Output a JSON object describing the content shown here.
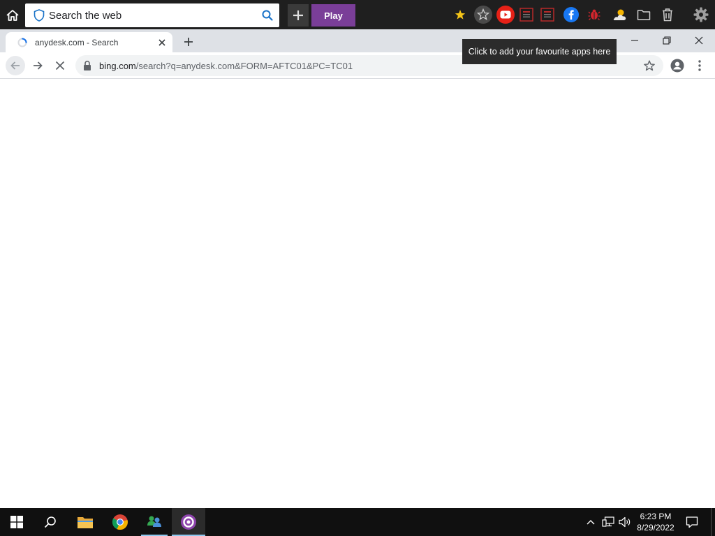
{
  "launcher": {
    "search_placeholder": "Search the web",
    "play_label": "Play",
    "favourites_tooltip": "Click to add your favourite apps here",
    "icons": [
      "home-icon",
      "shield-icon",
      "search-icon",
      "plus-icon",
      "star-icon",
      "favourites-icon",
      "youtube-icon",
      "news-icon",
      "news-icon",
      "facebook-icon",
      "bug-icon",
      "weather-icon",
      "folder-icon",
      "trash-icon",
      "gear-icon"
    ],
    "colors": {
      "bar": "#1f1f1f",
      "play": "#7a3e98",
      "star": "#f5c518",
      "youtube": "#e62117",
      "facebook": "#1877f2"
    }
  },
  "browser": {
    "tab": {
      "title": "anydesk.com - Search",
      "loading": true
    },
    "address": {
      "host": "bing.com",
      "path": "/search?q=anydesk.com&FORM=AFTC01&PC=TC01"
    }
  },
  "taskbar": {
    "clock_time": "6:23 PM",
    "clock_date": "8/29/2022",
    "icons": [
      "windows-start-icon",
      "search-icon",
      "file-explorer-icon",
      "chrome-icon",
      "msn-icon",
      "app-icon",
      "chevron-up-icon",
      "network-icon",
      "volume-icon",
      "notifications-icon"
    ]
  }
}
